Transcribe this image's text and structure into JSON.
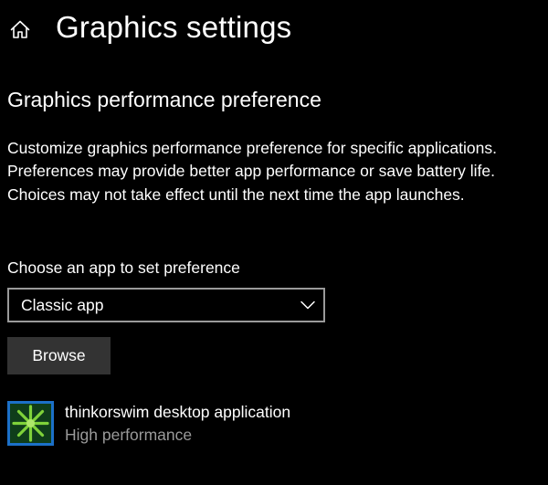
{
  "header": {
    "home_icon": "home-icon",
    "title": "Graphics settings"
  },
  "section": {
    "title": "Graphics performance preference",
    "description": "Customize graphics performance preference for specific applications. Preferences may provide better app performance or save battery life. Choices may not take effect until the next time the app launches."
  },
  "picker": {
    "label": "Choose an app to set preference",
    "selected": "Classic app",
    "chevron_icon": "chevron-down-icon",
    "browse_label": "Browse"
  },
  "apps": [
    {
      "name": "thinkorswim desktop application",
      "preference": "High performance",
      "icon": "thinkorswim-icon"
    }
  ],
  "colors": {
    "background": "#000000",
    "text": "#ffffff",
    "secondary_text": "#9a9a9a",
    "dropdown_border": "#9a9a9a",
    "button_bg": "#333333",
    "app_icon_blue": "#1c70c8",
    "app_icon_green": "#7fd23a"
  }
}
